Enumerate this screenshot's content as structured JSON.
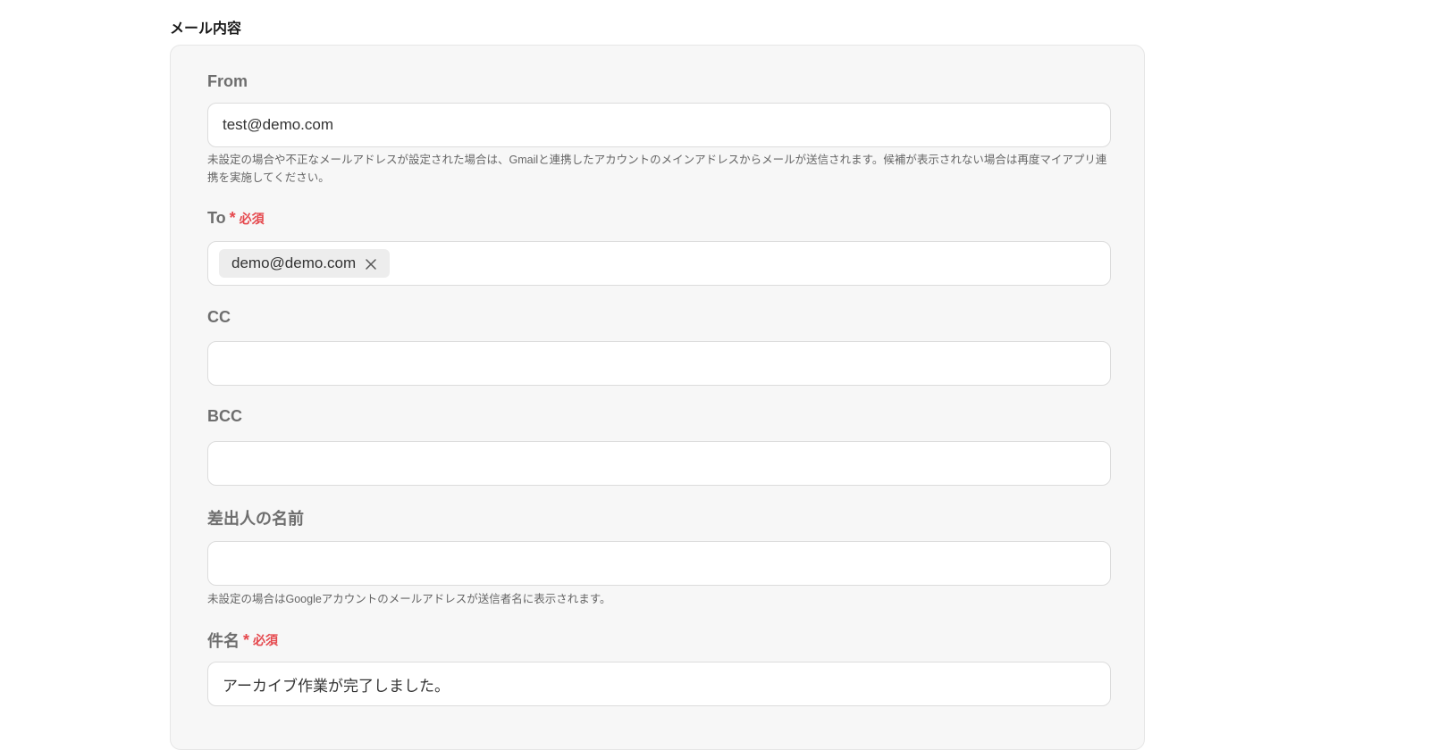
{
  "section": {
    "title": "メール内容"
  },
  "fields": {
    "from": {
      "label": "From",
      "value": "test@demo.com",
      "help": "未設定の場合や不正なメールアドレスが設定された場合は、Gmailと連携したアカウントのメインアドレスからメールが送信されます。候補が表示されない場合は再度マイアプリ連携を実施してください。"
    },
    "to": {
      "label": "To",
      "required_mark": "*",
      "required_text": "必須",
      "chips": [
        "demo@demo.com"
      ]
    },
    "cc": {
      "label": "CC",
      "value": ""
    },
    "bcc": {
      "label": "BCC",
      "value": ""
    },
    "sender_name": {
      "label": "差出人の名前",
      "value": "",
      "help": "未設定の場合はGoogleアカウントのメールアドレスが送信者名に表示されます。"
    },
    "subject": {
      "label": "件名",
      "required_mark": "*",
      "required_text": "必須",
      "value": "アーカイブ作業が完了しました。"
    }
  },
  "colors": {
    "required": "#e5484d",
    "panel_bg": "#f7f7f7",
    "label": "#6e6e6e"
  },
  "icons": {
    "chip_remove": "close-icon"
  }
}
